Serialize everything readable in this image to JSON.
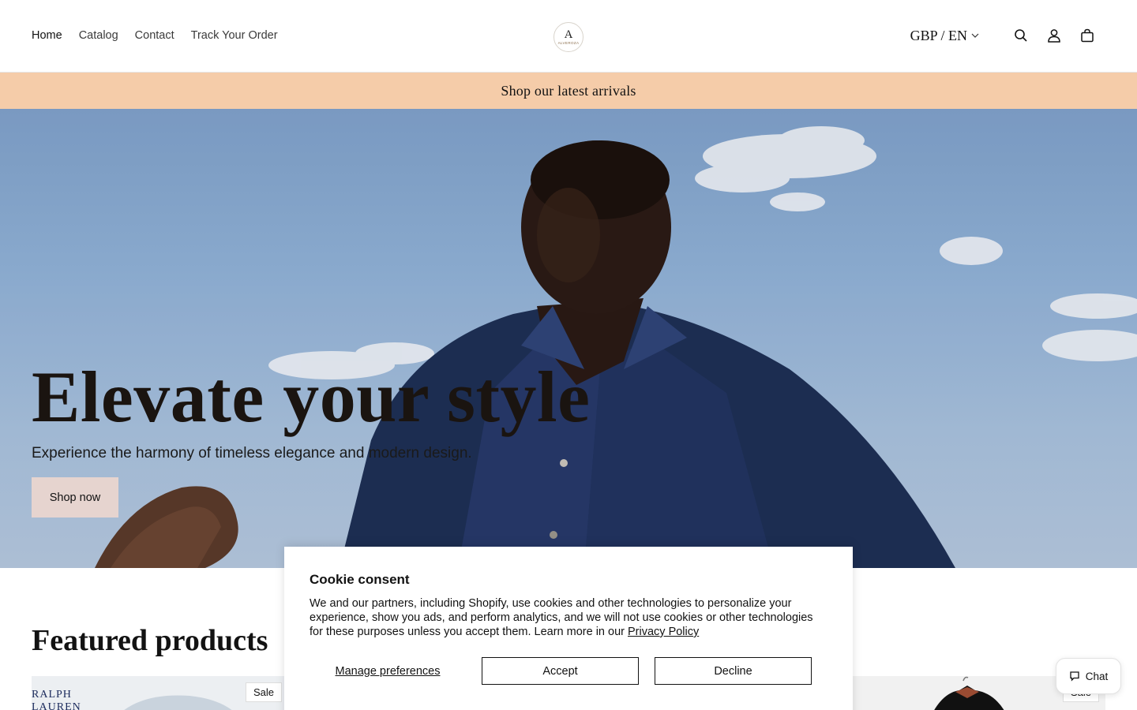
{
  "nav": {
    "items": [
      {
        "label": "Home",
        "active": true
      },
      {
        "label": "Catalog"
      },
      {
        "label": "Contact"
      },
      {
        "label": "Track Your Order"
      }
    ]
  },
  "logo": {
    "mark": "A",
    "wordmark": "ALVEROZA"
  },
  "header": {
    "locale": "GBP / EN",
    "icons": [
      "search-icon",
      "account-icon",
      "cart-icon"
    ]
  },
  "announcement": {
    "text": "Shop our latest arrivals",
    "bg_color": "#f5cca9"
  },
  "hero": {
    "title": "Elevate your style",
    "subtitle": "Experience the harmony of timeless elegance and modern design.",
    "button": "Shop now"
  },
  "featured": {
    "title": "Featured products",
    "cards": [
      {
        "badge": "Sale",
        "brand_lines": [
          "RALPH",
          "LAUREN"
        ]
      },
      {
        "badge": "Sale"
      }
    ]
  },
  "cookie": {
    "title": "Cookie consent",
    "body": "We and our partners, including Shopify, use cookies and other technologies to personalize your experience, show you ads, and perform analytics, and we will not use cookies or other technologies for these purposes unless you accept them. Learn more in our ",
    "link": "Privacy Policy",
    "manage": "Manage preferences",
    "accept": "Accept",
    "decline": "Decline"
  },
  "chat": {
    "label": "Chat"
  }
}
